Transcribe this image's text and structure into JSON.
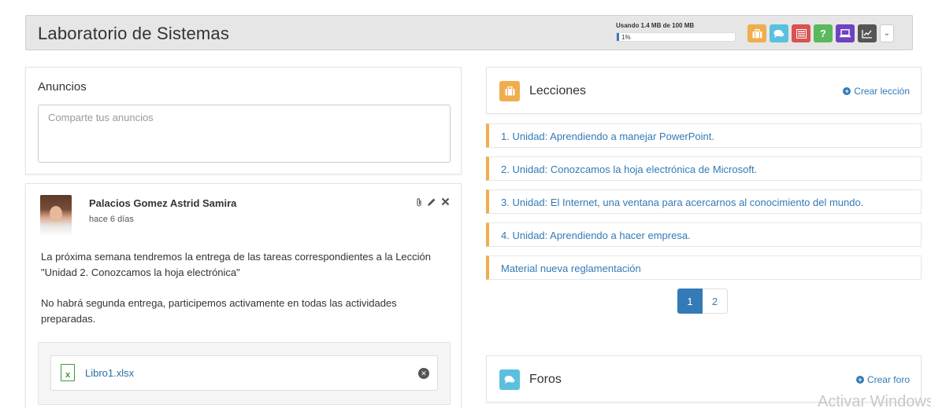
{
  "header": {
    "title": "Laboratorio de Sistemas",
    "usage_label": "Usando 1.4 MB de 100 MB",
    "usage_percent_text": "1%",
    "usage_fraction": 0.01,
    "icons": [
      {
        "name": "briefcase-icon",
        "color": "#f0ad4e"
      },
      {
        "name": "comments-icon",
        "color": "#5bc0de"
      },
      {
        "name": "list-icon",
        "color": "#d9534f"
      },
      {
        "name": "question-icon",
        "color": "#5cb85c",
        "glyph": "?"
      },
      {
        "name": "laptop-icon",
        "color": "#6f42c1"
      },
      {
        "name": "chart-icon",
        "color": "#555555"
      }
    ]
  },
  "anuncios": {
    "title": "Anuncios",
    "placeholder": "Comparte tus anuncios"
  },
  "post": {
    "author": "Palacios Gomez Astrid Samira",
    "time": "hace 6 días",
    "paragraph1": "La próxima semana tendremos la entrega de las tareas correspondientes a la Lección \"Unidad 2. Conozcamos la hoja electrónica\"",
    "paragraph2": "No habrá segunda entrega, participemos activamente en todas las actividades preparadas.",
    "attachment": "Libro1.xlsx"
  },
  "lecciones": {
    "title": "Lecciones",
    "create_label": "Crear lección",
    "items": [
      "1. Unidad: Aprendiendo a manejar PowerPoint.",
      "2. Unidad: Conozcamos la hoja electrónica de Microsoft.",
      "3. Unidad: El Internet, una ventana para acercarnos al conocimiento del mundo.",
      "4. Unidad: Aprendiendo a hacer empresa.",
      "Material nueva reglamentación"
    ],
    "pages": [
      "1",
      "2"
    ]
  },
  "foros": {
    "title": "Foros",
    "create_label": "Crear foro"
  },
  "watermark": "Activar Windows",
  "colors": {
    "accent": "#337ab7",
    "lesson_border": "#f0ad4e"
  }
}
